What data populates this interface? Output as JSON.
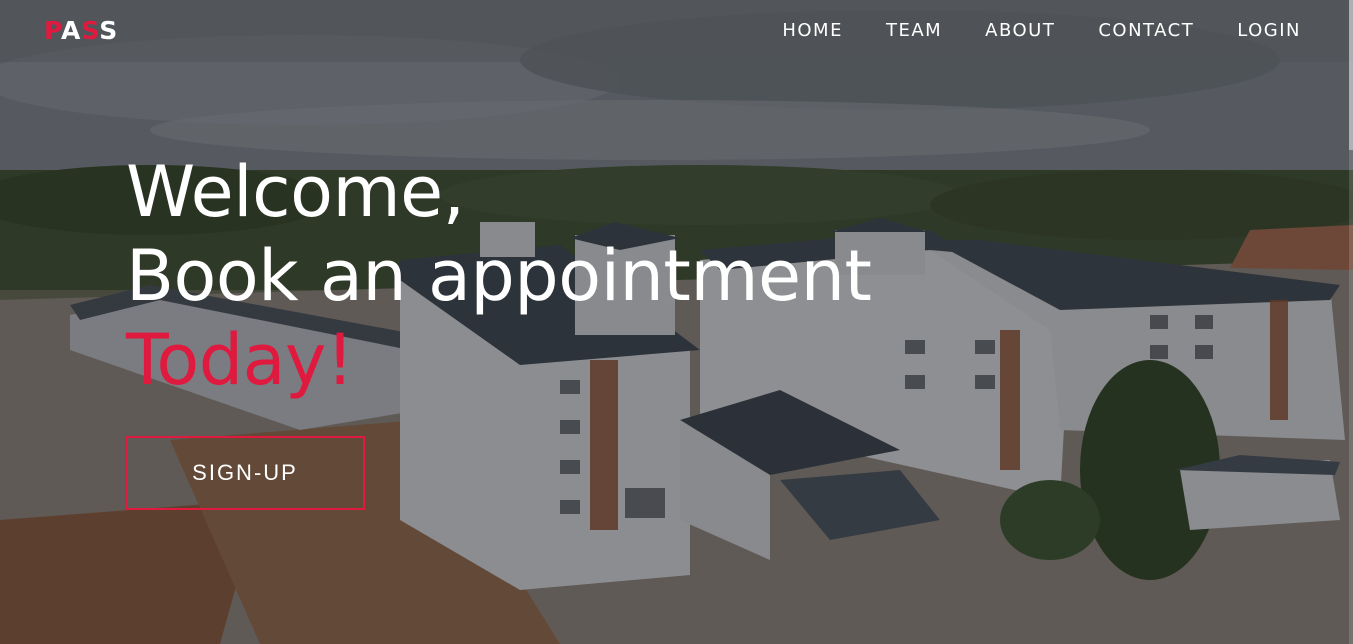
{
  "brand": {
    "logo_p": "P",
    "logo_a": "A",
    "logo_s1": "S",
    "logo_s2": "S"
  },
  "nav": {
    "items": [
      {
        "label": "HOME"
      },
      {
        "label": "TEAM"
      },
      {
        "label": "ABOUT"
      },
      {
        "label": "CONTACT"
      },
      {
        "label": "LOGIN"
      }
    ]
  },
  "hero": {
    "line1": "Welcome,",
    "line2": "Book an appointment",
    "line3": "Today!",
    "cta_label": "SIGN-UP"
  },
  "colors": {
    "accent": "#e0193f",
    "text": "#ffffff"
  },
  "icons": {
    "background": "campus-building-photo"
  }
}
